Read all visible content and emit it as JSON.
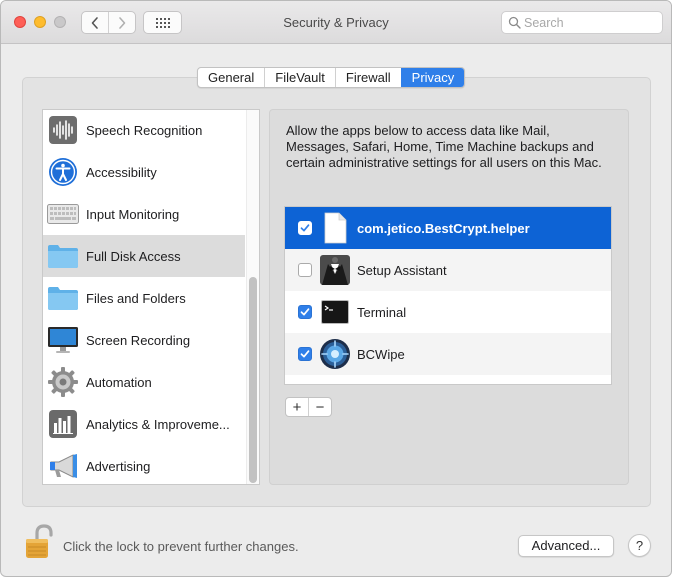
{
  "window": {
    "title": "Security & Privacy",
    "search_placeholder": "Search"
  },
  "tabs": [
    {
      "label": "General",
      "active": false
    },
    {
      "label": "FileVault",
      "active": false
    },
    {
      "label": "Firewall",
      "active": false
    },
    {
      "label": "Privacy",
      "active": true
    }
  ],
  "sidebar": {
    "items": [
      {
        "label": "Speech Recognition",
        "icon": "speech-recognition-icon"
      },
      {
        "label": "Accessibility",
        "icon": "accessibility-icon"
      },
      {
        "label": "Input Monitoring",
        "icon": "keyboard-icon"
      },
      {
        "label": "Full Disk Access",
        "icon": "folder-icon",
        "selected": true
      },
      {
        "label": "Files and Folders",
        "icon": "folder-icon"
      },
      {
        "label": "Screen Recording",
        "icon": "display-icon"
      },
      {
        "label": "Automation",
        "icon": "gear-icon"
      },
      {
        "label": "Analytics & Improveme...",
        "icon": "analytics-icon"
      },
      {
        "label": "Advertising",
        "icon": "megaphone-icon"
      }
    ]
  },
  "panel": {
    "description": "Allow the apps below to access data like Mail, Messages, Safari, Home, Time Machine backups and certain administrative settings for all users on this Mac.",
    "apps": [
      {
        "name": "com.jetico.BestCrypt.helper",
        "checked": true,
        "selected": true,
        "icon": "document-icon"
      },
      {
        "name": "Setup Assistant",
        "checked": false,
        "icon": "setup-assistant-icon"
      },
      {
        "name": "Terminal",
        "checked": true,
        "icon": "terminal-icon"
      },
      {
        "name": "BCWipe",
        "checked": true,
        "icon": "bcwipe-icon"
      }
    ],
    "add_label": "+",
    "remove_label": "−"
  },
  "footer": {
    "lock_text": "Click the lock to prevent further changes.",
    "advanced_label": "Advanced...",
    "help_label": "?"
  },
  "colors": {
    "accent": "#2f7fe9",
    "selection": "#0d63d5",
    "window_bg": "#ececec"
  }
}
